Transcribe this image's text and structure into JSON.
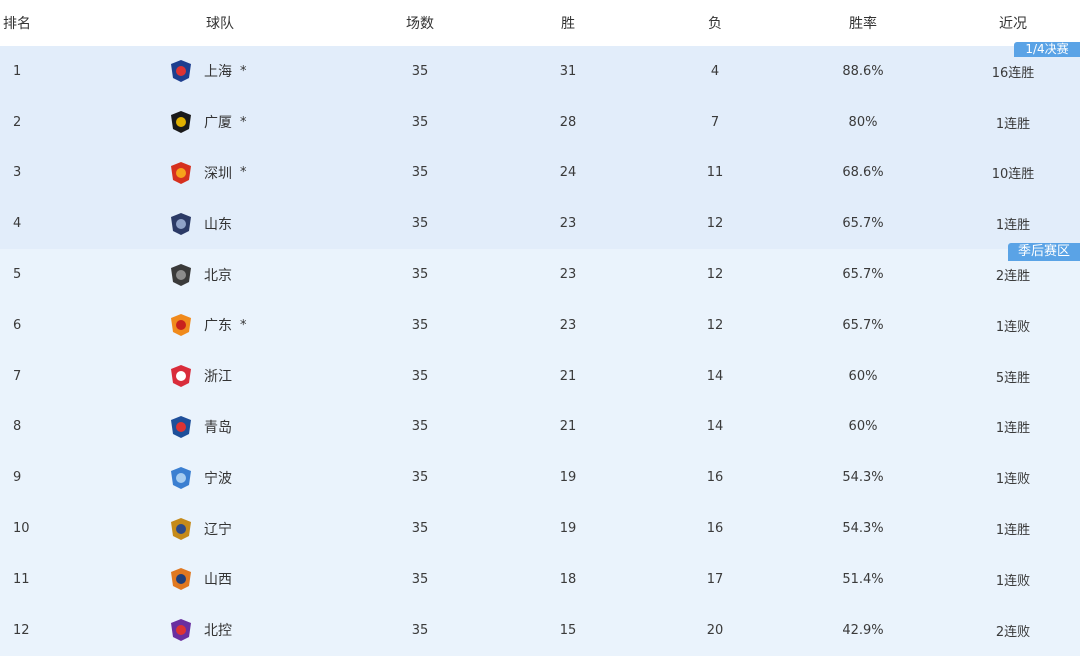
{
  "header": {
    "rank": "排名",
    "team": "球队",
    "games": "场数",
    "win": "胜",
    "loss": "负",
    "pct": "胜率",
    "streak": "近况"
  },
  "zones": {
    "quarterfinal": "1/4决赛",
    "playoff": "季后赛区"
  },
  "colors": {
    "top4_bg": "#e2edfa",
    "playoff_bg": "#eaf3fc",
    "tag_bg": "#5aa3e6"
  },
  "rows": [
    {
      "rank": "1",
      "team": "上海",
      "star": "*",
      "games": "35",
      "win": "31",
      "loss": "4",
      "pct": "88.6%",
      "streak": "16连胜",
      "logo": "shanghai-logo-icon"
    },
    {
      "rank": "2",
      "team": "广厦",
      "star": "*",
      "games": "35",
      "win": "28",
      "loss": "7",
      "pct": "80%",
      "streak": "1连胜",
      "logo": "guangsha-logo-icon"
    },
    {
      "rank": "3",
      "team": "深圳",
      "star": "*",
      "games": "35",
      "win": "24",
      "loss": "11",
      "pct": "68.6%",
      "streak": "10连胜",
      "logo": "shenzhen-logo-icon"
    },
    {
      "rank": "4",
      "team": "山东",
      "star": "",
      "games": "35",
      "win": "23",
      "loss": "12",
      "pct": "65.7%",
      "streak": "1连胜",
      "logo": "shandong-logo-icon"
    },
    {
      "rank": "5",
      "team": "北京",
      "star": "",
      "games": "35",
      "win": "23",
      "loss": "12",
      "pct": "65.7%",
      "streak": "2连胜",
      "logo": "beijing-logo-icon"
    },
    {
      "rank": "6",
      "team": "广东",
      "star": "*",
      "games": "35",
      "win": "23",
      "loss": "12",
      "pct": "65.7%",
      "streak": "1连败",
      "logo": "guangdong-logo-icon"
    },
    {
      "rank": "7",
      "team": "浙江",
      "star": "",
      "games": "35",
      "win": "21",
      "loss": "14",
      "pct": "60%",
      "streak": "5连胜",
      "logo": "zhejiang-logo-icon"
    },
    {
      "rank": "8",
      "team": "青岛",
      "star": "",
      "games": "35",
      "win": "21",
      "loss": "14",
      "pct": "60%",
      "streak": "1连胜",
      "logo": "qingdao-logo-icon"
    },
    {
      "rank": "9",
      "team": "宁波",
      "star": "",
      "games": "35",
      "win": "19",
      "loss": "16",
      "pct": "54.3%",
      "streak": "1连败",
      "logo": "ningbo-logo-icon"
    },
    {
      "rank": "10",
      "team": "辽宁",
      "star": "",
      "games": "35",
      "win": "19",
      "loss": "16",
      "pct": "54.3%",
      "streak": "1连胜",
      "logo": "liaoning-logo-icon"
    },
    {
      "rank": "11",
      "team": "山西",
      "star": "",
      "games": "35",
      "win": "18",
      "loss": "17",
      "pct": "51.4%",
      "streak": "1连败",
      "logo": "shanxi-logo-icon"
    },
    {
      "rank": "12",
      "team": "北控",
      "star": "",
      "games": "35",
      "win": "15",
      "loss": "20",
      "pct": "42.9%",
      "streak": "2连败",
      "logo": "beikong-logo-icon"
    }
  ]
}
